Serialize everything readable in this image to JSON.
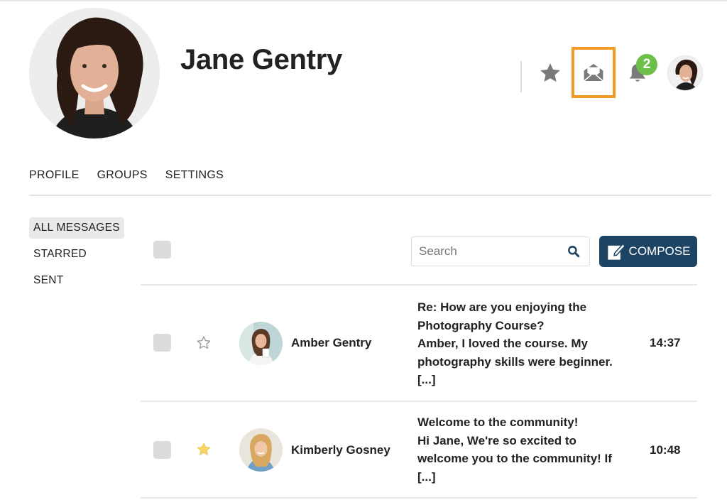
{
  "profile": {
    "name": "Jane Gentry"
  },
  "header": {
    "notification_count": "2"
  },
  "tabs": [
    "PROFILE",
    "GROUPS",
    "SETTINGS"
  ],
  "sidebar": {
    "items": [
      "ALL MESSAGES",
      "STARRED",
      "SENT"
    ]
  },
  "toolbar": {
    "search_placeholder": "Search",
    "compose_label": "COMPOSE"
  },
  "messages": [
    {
      "sender": "Amber Gentry",
      "starred": false,
      "lines": [
        "Re: How are you enjoying the",
        "Photography Course?",
        "Amber, I loved the course. My",
        "photography skills were beginner.",
        "[...]"
      ],
      "time": "14:37"
    },
    {
      "sender": "Kimberly Gosney",
      "starred": true,
      "lines": [
        "Welcome to the community!",
        "Hi Jane, We're so excited to",
        "welcome you to the community! If",
        "[...]"
      ],
      "time": "10:48"
    }
  ],
  "colors": {
    "highlight": "#f39a24",
    "compose_bg": "#1e4463",
    "badge": "#6cc04a",
    "star_active": "#f6d46a",
    "icon_gray": "#7a7a7a"
  },
  "icons": [
    "star-icon",
    "mail-open-icon",
    "bell-icon",
    "search-icon",
    "compose-icon",
    "star-outline-icon",
    "star-filled-icon"
  ]
}
